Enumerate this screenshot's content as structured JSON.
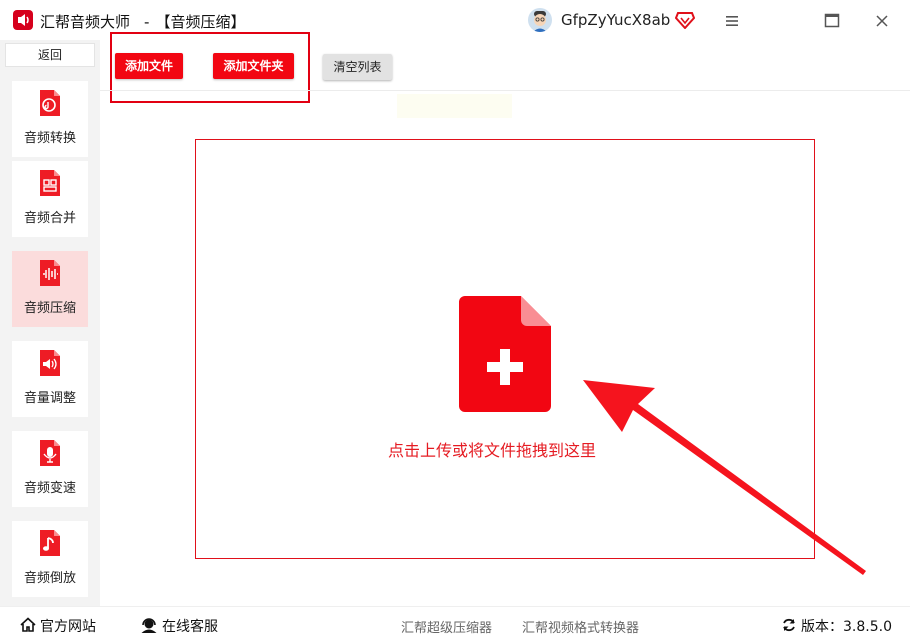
{
  "titlebar": {
    "app_name": "汇帮音频大师",
    "separator": "-",
    "module": "【音频压缩】",
    "username": "GfpZyYucX8ab"
  },
  "sidebar": {
    "back_label": "返回",
    "items": [
      {
        "label": "音频转换",
        "icon": "audio-convert-icon"
      },
      {
        "label": "音频合并",
        "icon": "audio-merge-icon"
      },
      {
        "label": "音频压缩",
        "icon": "audio-compress-icon",
        "active": true
      },
      {
        "label": "音量调整",
        "icon": "volume-icon"
      },
      {
        "label": "音频变速",
        "icon": "microphone-icon"
      },
      {
        "label": "音频倒放",
        "icon": "music-note-icon"
      }
    ]
  },
  "toolbar": {
    "add_file": "添加文件",
    "add_folder": "添加文件夹",
    "clear_list": "清空列表"
  },
  "dropzone": {
    "hint": "点击上传或将文件拖拽到这里"
  },
  "footer": {
    "official_site": "官方网站",
    "online_service": "在线客服",
    "link_compressor": "汇帮超级压缩器",
    "link_video_converter": "汇帮视频格式转换器",
    "version": "版本：3.8.5.0"
  },
  "colors": {
    "accent": "#f20612",
    "active_bg": "#fbdcdc",
    "sidebar_bg": "#f3f3f3"
  }
}
